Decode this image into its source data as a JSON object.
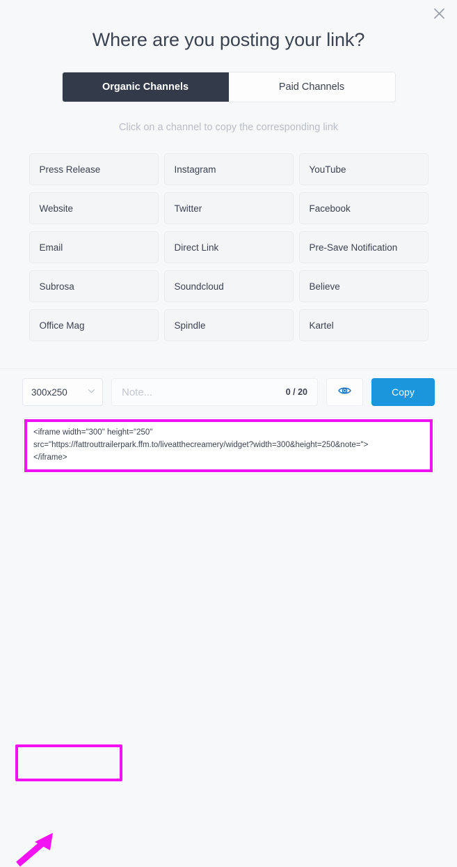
{
  "modal": {
    "title": "Where are you posting your link?",
    "close_icon": "close-icon"
  },
  "tabs": [
    {
      "label": "Organic Channels",
      "active": true
    },
    {
      "label": "Paid Channels",
      "active": false
    }
  ],
  "hint": "Click on a channel to copy the corresponding link",
  "channels": [
    "Press Release",
    "Instagram",
    "YouTube",
    "Website",
    "Twitter",
    "Facebook",
    "Email",
    "Direct Link",
    "Pre-Save Notification",
    "Subrosa",
    "Soundcloud",
    "Believe",
    "Office Mag",
    "Spindle",
    "Kartel"
  ],
  "footer": {
    "size_select": {
      "value": "300x250",
      "caret_icon": "chevron-down-icon"
    },
    "note": {
      "placeholder": "Note...",
      "value": "",
      "counter": "0 / 20"
    },
    "preview_button": {
      "icon": "eye-icon"
    },
    "copy_button": {
      "label": "Copy"
    }
  },
  "embed_code": {
    "line1": "<iframe width=\"300\" height=\"250\"",
    "line2": "src=\"https://fattrouttrailerpark.ffm.to/liveatthecreamery/widget?width=300&height=250&note=\">",
    "line3": "</iframe>"
  },
  "annotations": {
    "highlight_color": "#f312f3",
    "arrow_icon": "arrow-pointing-up-right"
  },
  "colors": {
    "page_background": "#f7f8fa",
    "tab_active": "#333b4a",
    "copy_button": "#1b96dd",
    "text": "#3b4250",
    "muted_text": "#b9bdc7"
  }
}
